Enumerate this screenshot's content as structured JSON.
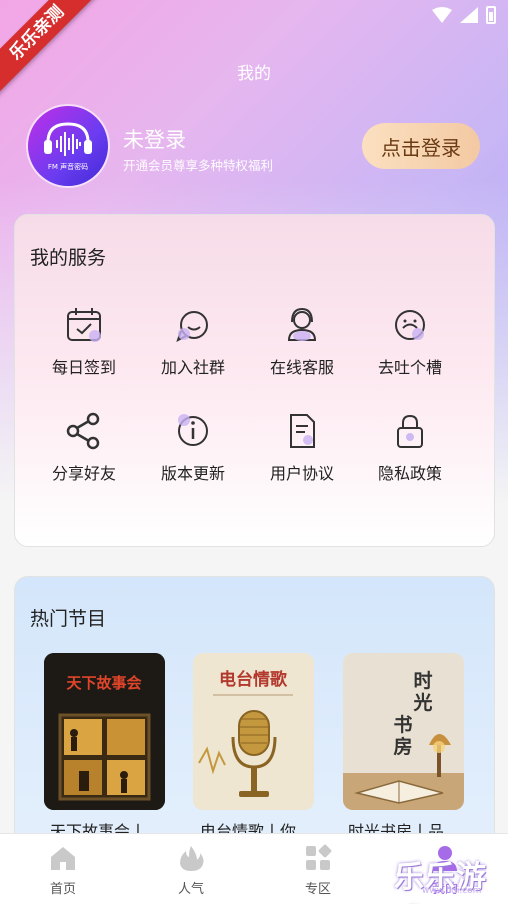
{
  "ribbon": {
    "text": "乐乐亲测"
  },
  "header": {
    "title": "我的"
  },
  "user": {
    "name": "未登录",
    "subtitle": "开通会员尊享多种特权福利",
    "login_button": "点击登录",
    "avatar_text": "FM 声音密码"
  },
  "services": {
    "title": "我的服务",
    "items": [
      {
        "label": "每日签到",
        "icon": "calendar-check-icon"
      },
      {
        "label": "加入社群",
        "icon": "chat-bubble-icon"
      },
      {
        "label": "在线客服",
        "icon": "headset-icon"
      },
      {
        "label": "去吐个槽",
        "icon": "feedback-icon"
      },
      {
        "label": "分享好友",
        "icon": "share-icon"
      },
      {
        "label": "版本更新",
        "icon": "info-icon"
      },
      {
        "label": "用户协议",
        "icon": "document-icon"
      },
      {
        "label": "隐私政策",
        "icon": "lock-icon"
      }
    ]
  },
  "hot": {
    "title": "热门节目",
    "programs": [
      {
        "name": "天下故事会丨",
        "cover_title": "天下故事会"
      },
      {
        "name": "电台情歌丨你",
        "cover_title": "电台情歌"
      },
      {
        "name": "时光书房丨品",
        "cover_title": "时光书房"
      }
    ]
  },
  "tabbar": {
    "tabs": [
      {
        "label": "首页"
      },
      {
        "label": "人气"
      },
      {
        "label": "专区"
      },
      {
        "label": "我的"
      }
    ]
  },
  "watermark": {
    "text": "乐乐游戏",
    "url": "www.lldi.com"
  },
  "colors": {
    "accent": "#a66be8",
    "login_btn": "#f3c9a3",
    "ribbon": "#d62d2d"
  }
}
